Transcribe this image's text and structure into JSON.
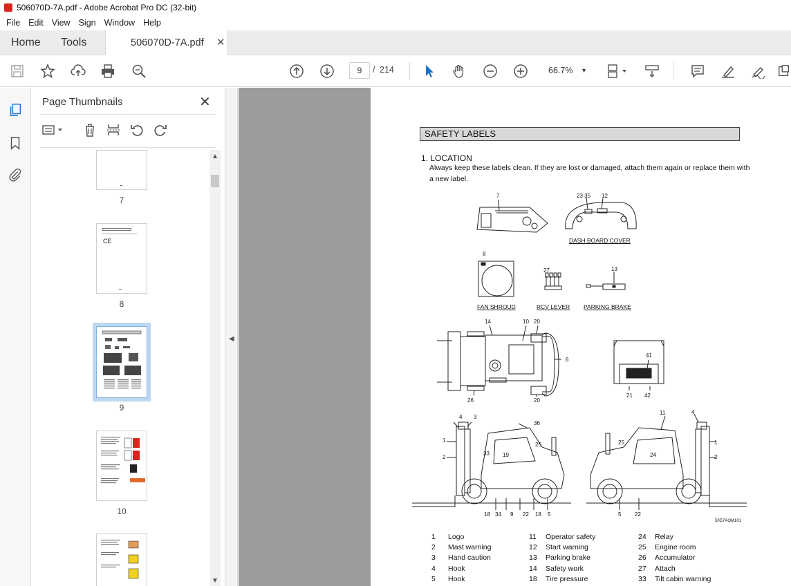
{
  "window": {
    "title": "506070D-7A.pdf - Adobe Acrobat Pro DC (32-bit)"
  },
  "menu": [
    "File",
    "Edit",
    "View",
    "Sign",
    "Window",
    "Help"
  ],
  "tabs": {
    "home": "Home",
    "tools": "Tools",
    "document": "506070D-7A.pdf"
  },
  "toolbar": {
    "current_page": "9",
    "page_separator": "/",
    "total_pages": "214",
    "zoom": "66.7%"
  },
  "thumbnails_panel": {
    "title": "Page Thumbnails",
    "pages": [
      {
        "label": "7"
      },
      {
        "label": "8"
      },
      {
        "label": "9",
        "selected": true
      },
      {
        "label": "10"
      }
    ]
  },
  "document_page": {
    "section_title": "SAFETY LABELS",
    "location_heading": "1. LOCATION",
    "location_text_1": "Always keep these labels clean.  If they are lost or damaged, attach them again or replace them with",
    "location_text_2": "a new label.",
    "diagram_labels": {
      "dash_board_cover": "DASH BOARD COVER",
      "fan_shroud": "FAN SHROUD",
      "rcv_lever": "RCV LEVER",
      "parking_brake": "PARKING BRAKE"
    },
    "callouts": {
      "dash_1": "7",
      "dash_2": "23 35",
      "dash_3": "12",
      "fan": "8",
      "rcv": "27",
      "park": "13",
      "top_14": "14",
      "top_10": "10",
      "top_20a": "20",
      "top_6": "6",
      "top_26": "26",
      "top_20b": "20",
      "rear_41": "41",
      "rear_21": "21",
      "rear_42": "42",
      "left_4": "4",
      "left_3": "3",
      "left_36": "36",
      "left_1": "1",
      "left_25": "25",
      "left_2": "2",
      "left_33": "33",
      "left_19": "19",
      "left_18a": "18",
      "left_34": "34",
      "left_9": "9",
      "left_22": "22",
      "left_18b": "18",
      "left_5": "5",
      "right_11": "11",
      "right_4": "4",
      "right_25": "25",
      "right_1": "1",
      "right_24": "24",
      "right_2": "2",
      "right_5": "5",
      "right_22": "22"
    },
    "figure_code": "50D7AOM101",
    "legend": [
      [
        {
          "n": "1",
          "t": "Logo"
        },
        {
          "n": "2",
          "t": "Mast warning"
        },
        {
          "n": "3",
          "t": "Hand caution"
        },
        {
          "n": "4",
          "t": "Hook"
        },
        {
          "n": "5",
          "t": "Hook"
        }
      ],
      [
        {
          "n": "11",
          "t": "Operator safety"
        },
        {
          "n": "12",
          "t": "Start warning"
        },
        {
          "n": "13",
          "t": "Parking brake"
        },
        {
          "n": "14",
          "t": "Safety work"
        },
        {
          "n": "18",
          "t": "Tire pressure"
        }
      ],
      [
        {
          "n": "24",
          "t": "Relay"
        },
        {
          "n": "25",
          "t": "Engine room"
        },
        {
          "n": "26",
          "t": "Accumulator"
        },
        {
          "n": "27",
          "t": "Attach"
        },
        {
          "n": "33",
          "t": "Tilt cabin warning"
        }
      ]
    ]
  }
}
